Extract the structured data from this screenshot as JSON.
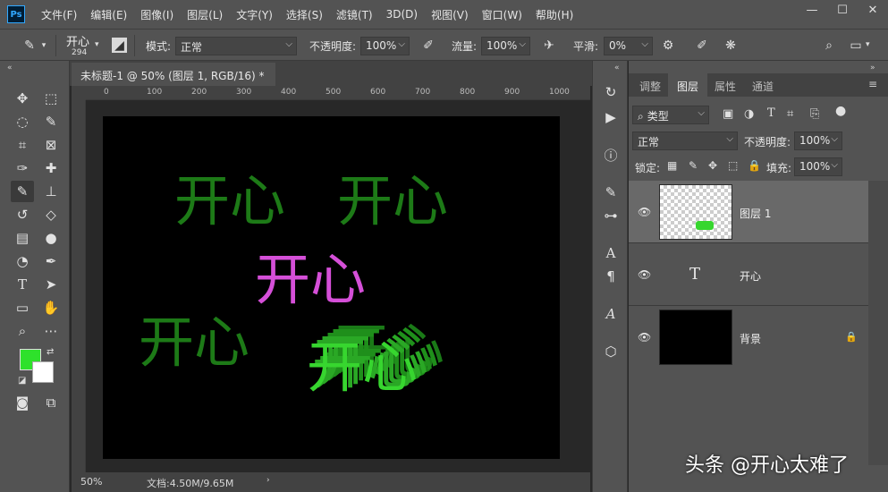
{
  "app": {
    "logo": "Ps",
    "menu": [
      "文件(F)",
      "编辑(E)",
      "图像(I)",
      "图层(L)",
      "文字(Y)",
      "选择(S)",
      "滤镜(T)",
      "3D(D)",
      "视图(V)",
      "窗口(W)",
      "帮助(H)"
    ],
    "window_controls": [
      "—",
      "☐",
      "✕"
    ]
  },
  "options": {
    "brush_preset_label": "开心",
    "brush_size": "294",
    "mode_label": "模式:",
    "mode_value": "正常",
    "opacity_label": "不透明度:",
    "opacity_value": "100%",
    "flow_label": "流量:",
    "flow_value": "100%",
    "smoothing_label": "平滑:",
    "smoothing_value": "0%"
  },
  "document": {
    "tab_title": "未标题-1 @ 50% (图层 1, RGB/16) *",
    "close": "×",
    "ruler_ticks": [
      "0",
      "100",
      "200",
      "300",
      "400",
      "500",
      "600",
      "700",
      "800",
      "900",
      "1000"
    ],
    "zoom": "50%",
    "doc_info": "文档:4.50M/9.65M",
    "canvas_texts": [
      {
        "text": "开心",
        "color": "#1d7a17"
      },
      {
        "text": "开心",
        "color": "#1d7a17"
      },
      {
        "text": "开心",
        "color": "#d54fd8"
      },
      {
        "text": "开心",
        "color": "#1d7a17"
      },
      {
        "text": "开心",
        "color": "#37d62f"
      }
    ]
  },
  "layers_panel": {
    "tabs": [
      "调整",
      "图层",
      "属性",
      "通道"
    ],
    "active_tab": "图层",
    "filter_value": "类型",
    "blend_value": "正常",
    "opacity_label": "不透明度:",
    "opacity_value": "100%",
    "lock_label": "锁定:",
    "fill_label": "填充:",
    "fill_value": "100%",
    "layers": [
      {
        "name": "图层 1",
        "selected": true
      },
      {
        "name": "开心",
        "type_glyph": "T"
      },
      {
        "name": "背景",
        "locked": true
      }
    ]
  },
  "colors": {
    "foreground": "#2ee12b",
    "background": "#ffffff"
  },
  "watermark": "头条 @开心太难了"
}
